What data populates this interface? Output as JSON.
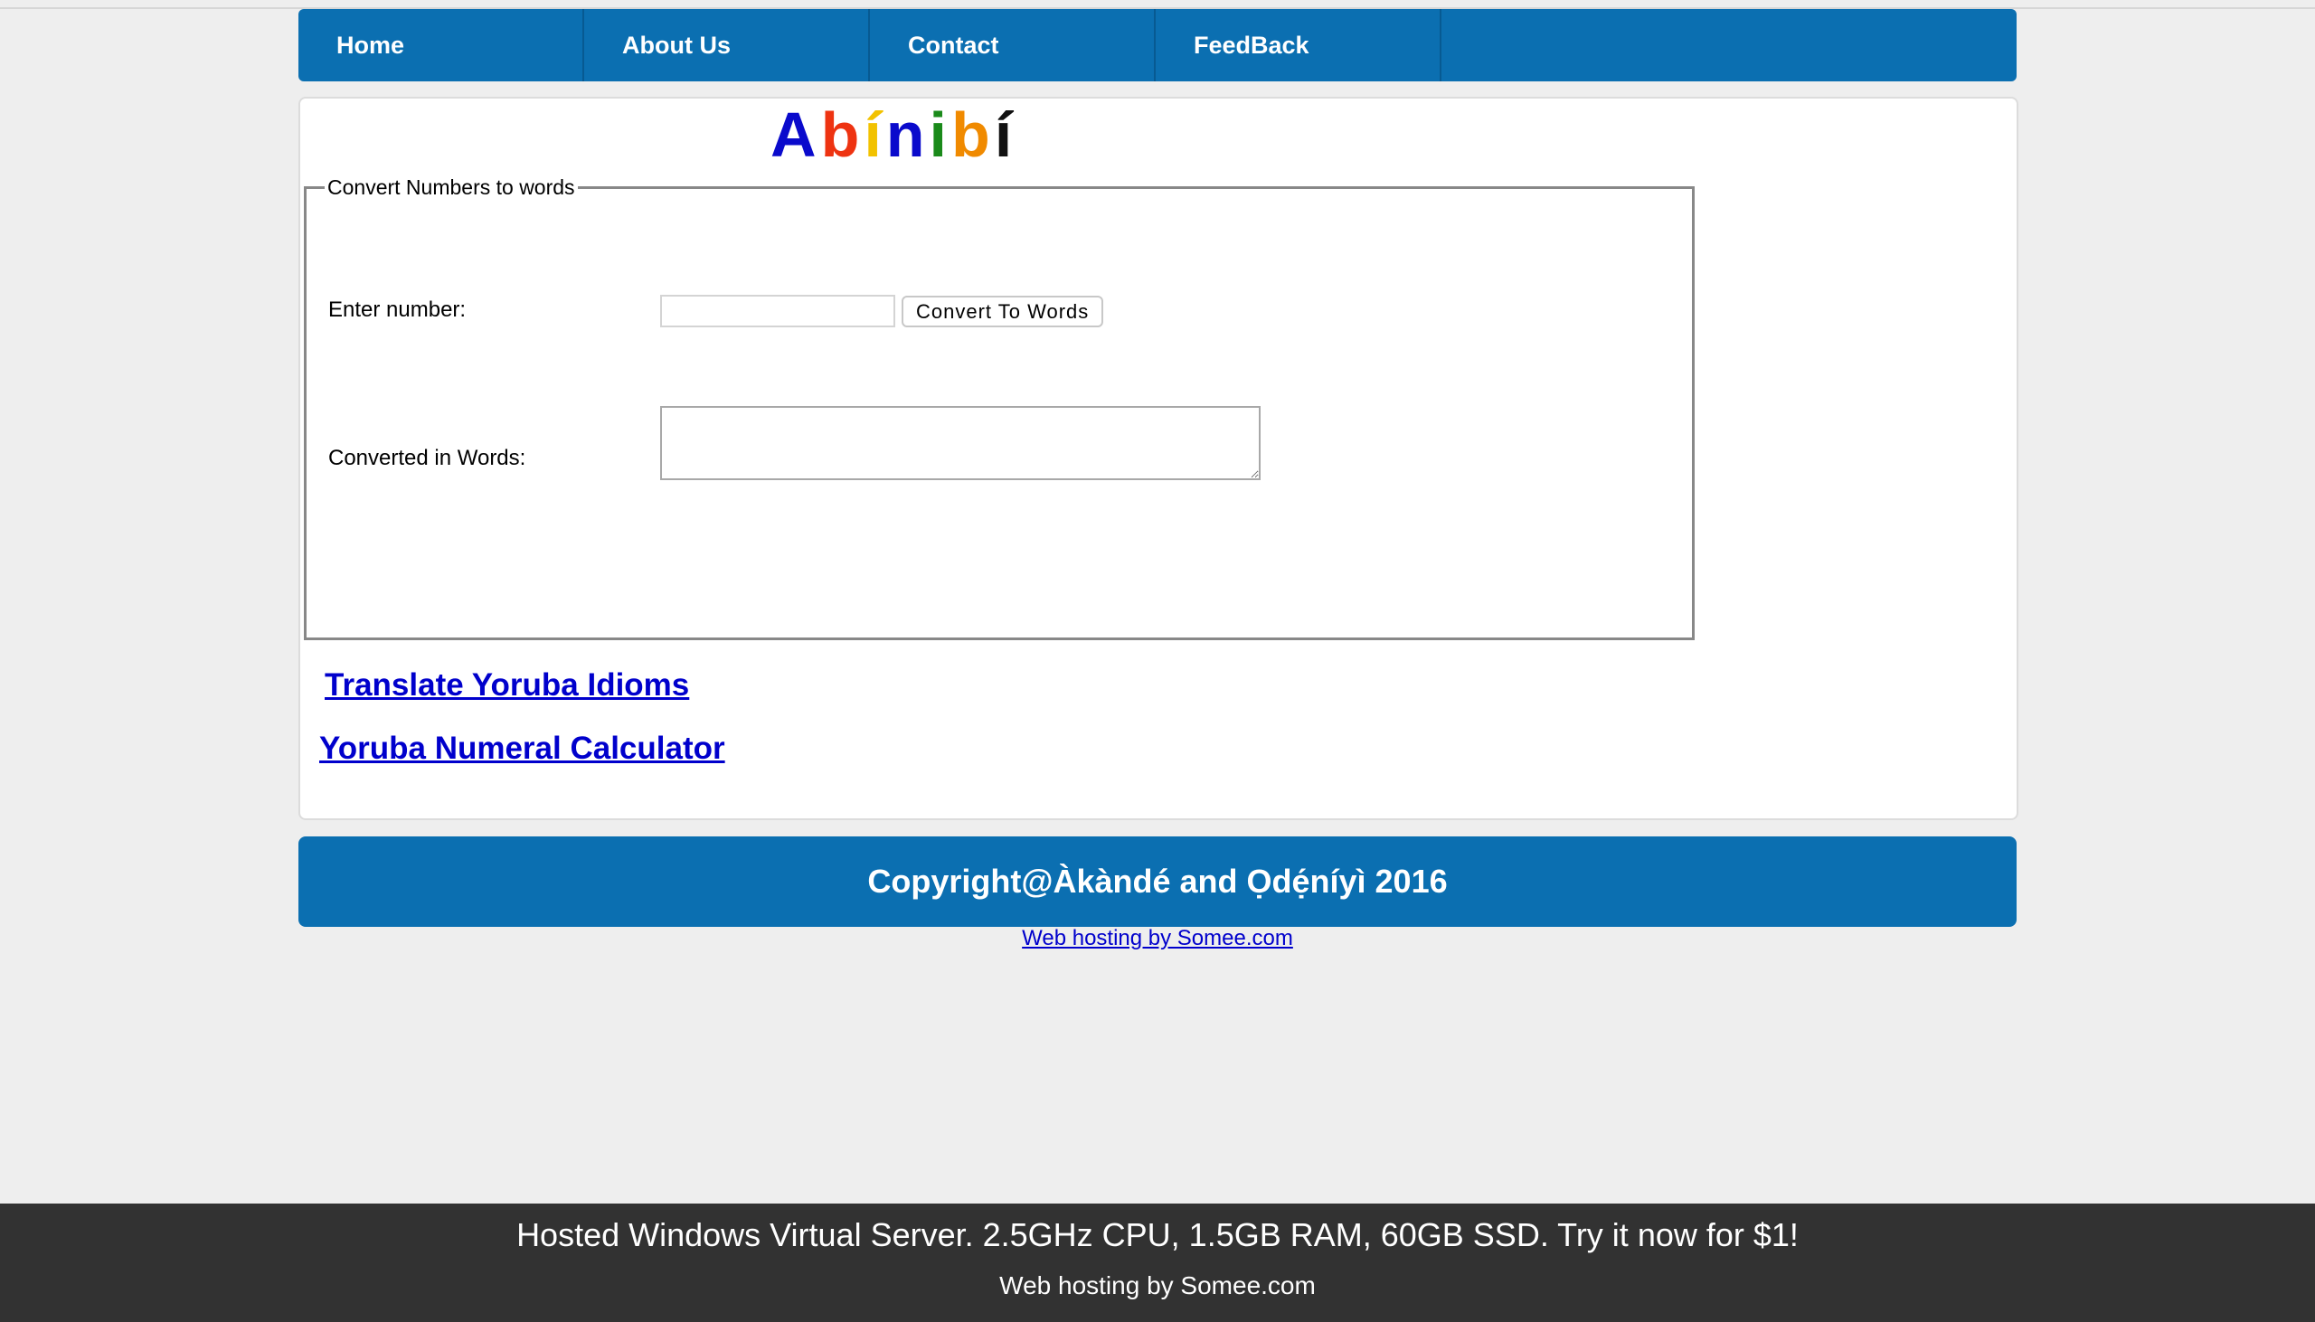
{
  "nav": {
    "items": [
      {
        "label": "Home"
      },
      {
        "label": "About Us"
      },
      {
        "label": "Contact"
      },
      {
        "label": "FeedBack"
      }
    ]
  },
  "logo": {
    "letters": [
      "A",
      "b",
      "í",
      "n",
      "i",
      "b",
      "í"
    ],
    "colors": [
      "#0a0acc",
      "#ee3311",
      "#f2c200",
      "#0a0acc",
      "#1a8a1a",
      "#f08a00",
      "#111111"
    ]
  },
  "converter": {
    "legend": "Convert Numbers to words",
    "enter_label": "Enter number:",
    "number_value": "",
    "button_label": "Convert To Words",
    "words_label": "Converted in Words:",
    "words_value": ""
  },
  "links": {
    "idioms": "Translate Yoruba Idioms ",
    "calculator": "Yoruba Numeral Calculator"
  },
  "copyright": "Copyright@Àkàndé and Ọdẹ́níyì 2016",
  "hosting_link": "Web hosting by Somee.com",
  "footer": {
    "ad": "Hosted Windows Virtual Server. 2.5GHz CPU, 1.5GB RAM, 60GB SSD. Try it now for $1!",
    "sub": "Web hosting by Somee.com"
  },
  "colors": {
    "brand_blue": "#0b6fb1",
    "link_blue": "#0000cc",
    "footer_bg": "#323232"
  }
}
